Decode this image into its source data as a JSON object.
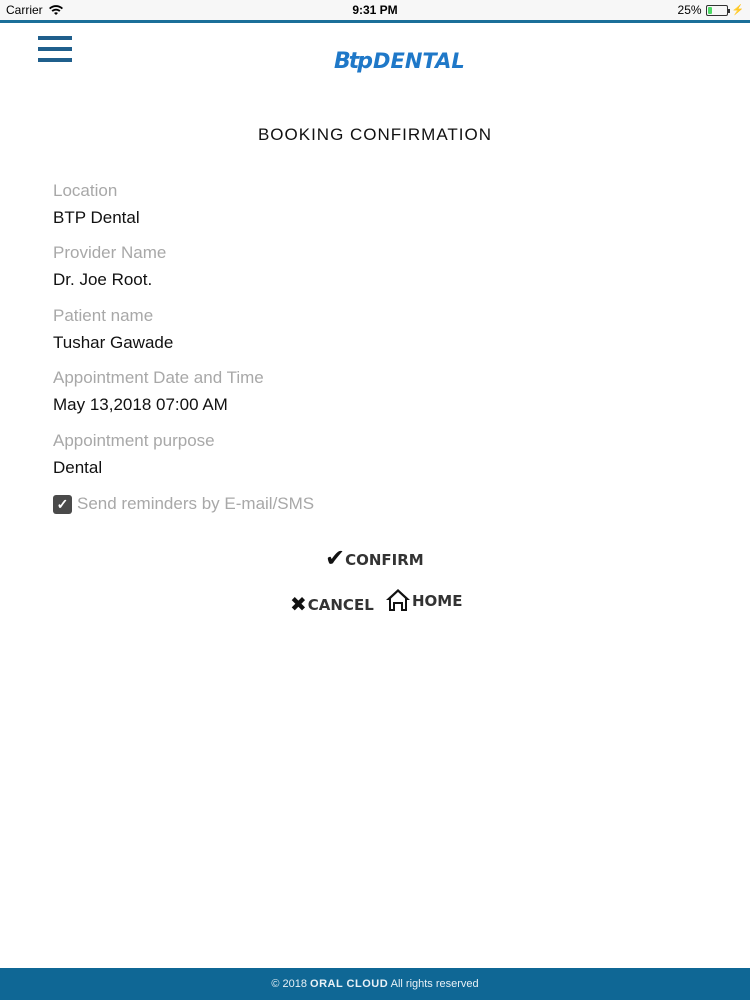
{
  "status_bar": {
    "carrier": "Carrier",
    "time": "9:31 PM",
    "battery": "25%",
    "battery_level": 0.25
  },
  "header": {
    "logo_mark": "Btp",
    "logo_text": "DENTAL"
  },
  "page_title": "BOOKING CONFIRMATION",
  "fields": [
    {
      "label": "Location",
      "value": "BTP Dental"
    },
    {
      "label": "Provider Name",
      "value": "Dr. Joe Root."
    },
    {
      "label": "Patient name",
      "value": "Tushar Gawade"
    },
    {
      "label": "Appointment Date and Time",
      "value": "May 13,2018 07:00 AM"
    },
    {
      "label": "Appointment purpose",
      "value": "Dental"
    }
  ],
  "reminder": {
    "label": "Send reminders by E-mail/SMS",
    "checked": true
  },
  "buttons": {
    "confirm": "CONFIRM",
    "cancel": "CANCEL",
    "home": "HOME"
  },
  "footer": {
    "prefix": "© 2018",
    "brand": "ORAL CLOUD",
    "suffix": "All rights reserved"
  }
}
